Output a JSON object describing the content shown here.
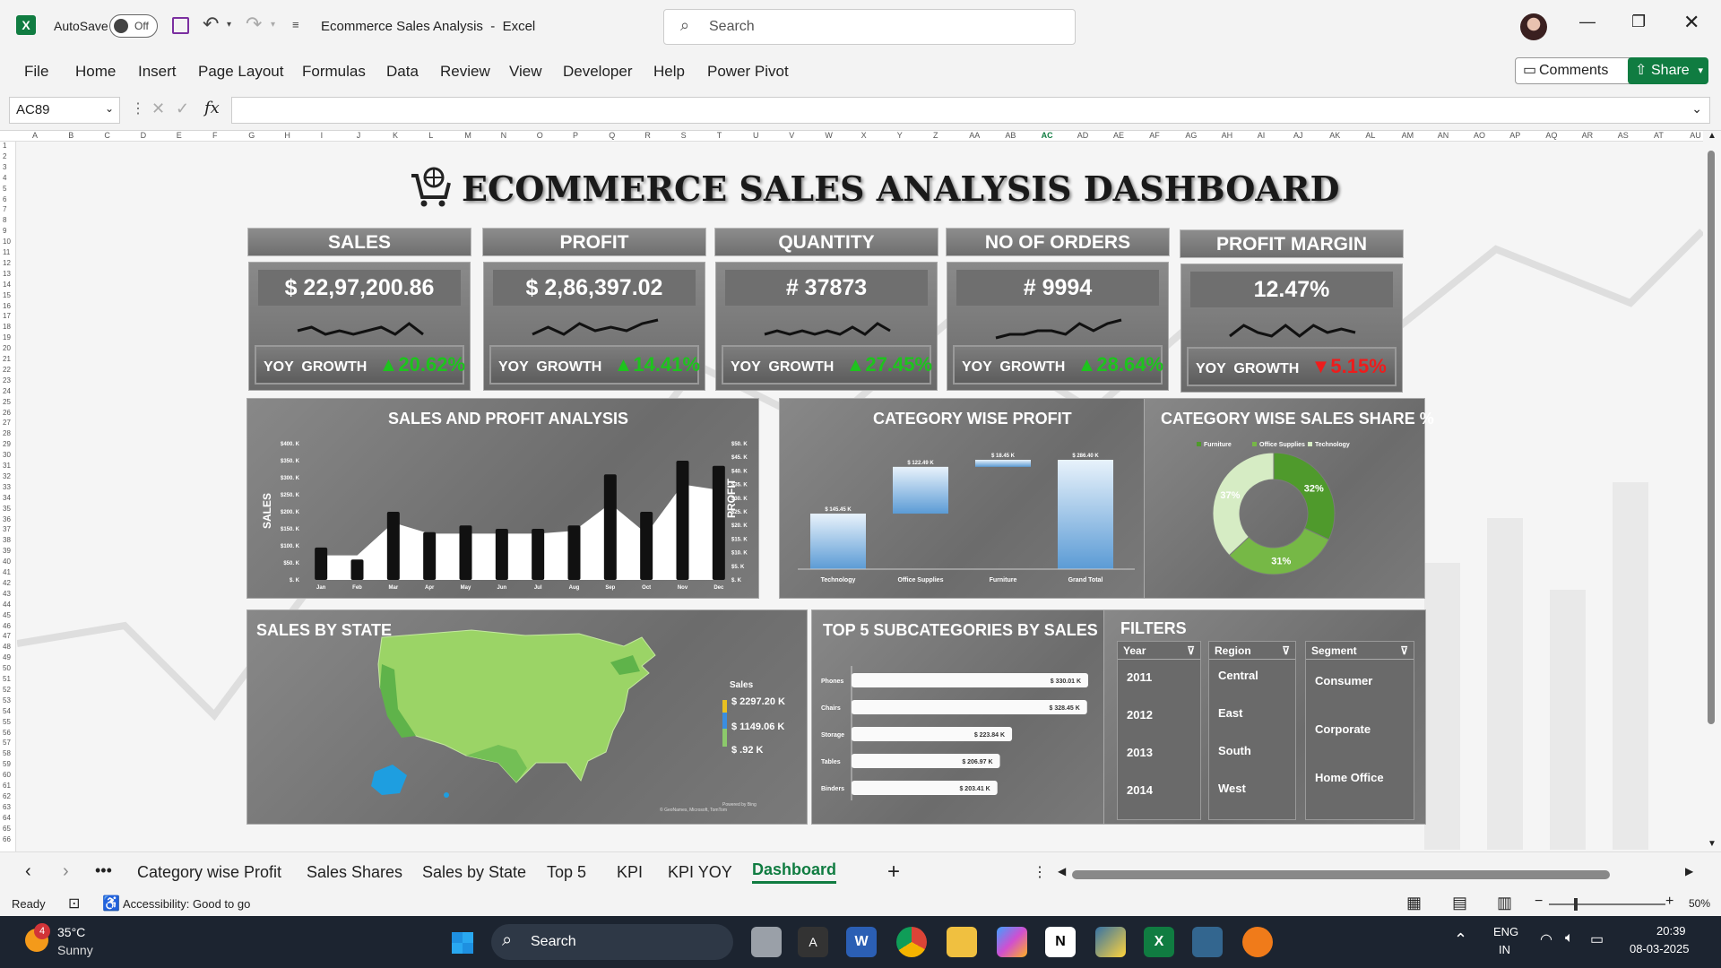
{
  "app": {
    "autosave_label": "AutoSave",
    "autosave_state": "Off",
    "doc_title": "Ecommerce Sales Analysis  -  Excel",
    "search_placeholder": "Search"
  },
  "ribbon": {
    "tabs": [
      "File",
      "Home",
      "Insert",
      "Page Layout",
      "Formulas",
      "Data",
      "Review",
      "View",
      "Developer",
      "Help",
      "Power Pivot"
    ],
    "comments": "Comments",
    "share": "Share"
  },
  "formula_bar": {
    "name_box": "AC89",
    "fx": "fx",
    "value": ""
  },
  "columns": [
    "A",
    "B",
    "C",
    "D",
    "E",
    "F",
    "G",
    "H",
    "I",
    "J",
    "K",
    "L",
    "M",
    "N",
    "O",
    "P",
    "Q",
    "R",
    "S",
    "T",
    "U",
    "V",
    "W",
    "X",
    "Y",
    "Z",
    "AA",
    "AB",
    "AC",
    "AD",
    "AE",
    "AF",
    "AG",
    "AH",
    "AI",
    "AJ",
    "AK",
    "AL",
    "AM",
    "AN",
    "AO",
    "AP",
    "AQ",
    "AR",
    "AS",
    "AT",
    "AU"
  ],
  "row_count": 66,
  "dashboard": {
    "title": "ECOMMERCE SALES ANALYSIS DASHBOARD",
    "kpis": [
      {
        "label": "SALES",
        "value": "$ 22,97,200.86",
        "yoy_label": "YOY  GROWTH",
        "yoy": "20.62%",
        "direction": "up",
        "trend": [
          5,
          4,
          6,
          5,
          6,
          5,
          4,
          6,
          3,
          6
        ]
      },
      {
        "label": "PROFIT",
        "value": "$ 2,86,397.02",
        "yoy_label": "YOY  GROWTH",
        "yoy": "14.41%",
        "direction": "up",
        "trend": [
          6,
          4,
          6,
          3,
          5,
          4,
          5,
          3,
          2
        ]
      },
      {
        "label": "QUANTITY",
        "value": "# 37873",
        "yoy_label": "YOY  GROWTH",
        "yoy": "27.45%",
        "direction": "up",
        "trend": [
          6,
          5,
          6,
          5,
          6,
          5,
          6,
          4,
          6,
          3,
          5
        ]
      },
      {
        "label": "NO OF ORDERS",
        "value": "# 9994",
        "yoy_label": "YOY  GROWTH",
        "yoy": "28.64%",
        "direction": "up",
        "trend": [
          7,
          6,
          6,
          5,
          5,
          6,
          3,
          5,
          3,
          2
        ]
      },
      {
        "label": "PROFIT MARGIN",
        "value": "12.47%",
        "yoy_label": "YOY  GROWTH",
        "yoy": "5.15%",
        "direction": "down",
        "trend": [
          6,
          3,
          5,
          6,
          3,
          6,
          3,
          5,
          4,
          5
        ]
      }
    ],
    "sales_profit_panel": {
      "title": "SALES AND PROFIT ANALYSIS",
      "ylabel": "SALES",
      "y2label": "PROFIT",
      "yticks": [
        "$400. K",
        "$350. K",
        "$300. K",
        "$250. K",
        "$200. K",
        "$150. K",
        "$100. K",
        "$50. K",
        "$. K"
      ],
      "y2ticks": [
        "$50. K",
        "$45. K",
        "$40. K",
        "$35. K",
        "$30. K",
        "$25. K",
        "$20. K",
        "$15. K",
        "$10. K",
        "$5. K",
        "$. K"
      ]
    },
    "category_profit_panel": {
      "title": "CATEGORY WISE PROFIT"
    },
    "sales_share_panel": {
      "title": "CATEGORY WISE SALES SHARE %"
    },
    "state_panel": {
      "title": "SALES BY STATE",
      "legend_title": "Sales",
      "legend": [
        "$ 2297.20 K",
        "$ 1149.06 K",
        "$ .92 K"
      ],
      "credit1": "Powered by Bing",
      "credit2": "© GeoNames, Microsoft, TomTom"
    },
    "top5_panel": {
      "title": "TOP 5 SUBCATEGORIES BY SALES"
    },
    "filters": {
      "title": "FILTERS",
      "year": {
        "label": "Year",
        "items": [
          "2011",
          "2012",
          "2013",
          "2014"
        ]
      },
      "region": {
        "label": "Region",
        "items": [
          "Central",
          "East",
          "South",
          "West"
        ]
      },
      "segment": {
        "label": "Segment",
        "items": [
          "Consumer",
          "Corporate",
          "Home Office"
        ]
      }
    }
  },
  "chart_data": [
    {
      "type": "bar",
      "title": "SALES AND PROFIT ANALYSIS",
      "categories": [
        "Jan",
        "Feb",
        "Mar",
        "Apr",
        "May",
        "Jun",
        "Jul",
        "Aug",
        "Sep",
        "Oct",
        "Nov",
        "Dec"
      ],
      "series": [
        {
          "name": "SALES",
          "values": [
            95,
            60,
            200,
            140,
            160,
            150,
            150,
            160,
            310,
            200,
            350,
            335
          ]
        },
        {
          "name": "PROFIT",
          "values": [
            9,
            9,
            21,
            17,
            17,
            17,
            17,
            18,
            28,
            17,
            35,
            33
          ]
        }
      ],
      "ylabel": "SALES",
      "y2label": "PROFIT",
      "ylim": [
        0,
        400
      ],
      "y2lim": [
        0,
        50
      ]
    },
    {
      "type": "bar",
      "title": "CATEGORY WISE PROFIT",
      "categories": [
        "Technology",
        "Office Supplies",
        "Furniture",
        "Grand Total"
      ],
      "values": [
        145.45,
        122.49,
        18.45,
        286.4
      ],
      "labels": [
        "$ 145.45 K",
        "$ 122.49 K",
        "$ 18.45 K",
        "$ 286.40 K"
      ]
    },
    {
      "type": "pie",
      "title": "CATEGORY WISE SALES SHARE %",
      "categories": [
        "Furniture",
        "Office Supplies",
        "Technology"
      ],
      "values": [
        32,
        31,
        37
      ],
      "labels": [
        "32%",
        "31%",
        "37%"
      ],
      "colors": [
        "#4f9a2c",
        "#76b846",
        "#d6ecc4"
      ],
      "legend": "top"
    },
    {
      "type": "bar",
      "title": "TOP 5 SUBCATEGORIES BY SALES",
      "categories": [
        "Phones",
        "Chairs",
        "Storage",
        "Tables",
        "Binders"
      ],
      "values": [
        330.01,
        328.45,
        223.84,
        206.97,
        203.41
      ],
      "labels": [
        "$ 330.01 K",
        "$ 328.45 K",
        "$ 223.84 K",
        "$ 206.97 K",
        "$ 203.41 K"
      ]
    }
  ],
  "sheet_tabs": {
    "tabs": [
      "Category wise Profit",
      "Sales Shares",
      "Sales by State",
      "Top 5",
      "KPI",
      "KPI YOY",
      "Dashboard"
    ],
    "active": "Dashboard"
  },
  "status": {
    "ready": "Ready",
    "accessibility": "Accessibility: Good to go",
    "zoom": "50%"
  },
  "taskbar": {
    "temp": "35°C",
    "weather": "Sunny",
    "badge": "4",
    "search": "Search",
    "lang1": "ENG",
    "lang2": "IN",
    "time": "20:39",
    "date": "08-03-2025"
  }
}
